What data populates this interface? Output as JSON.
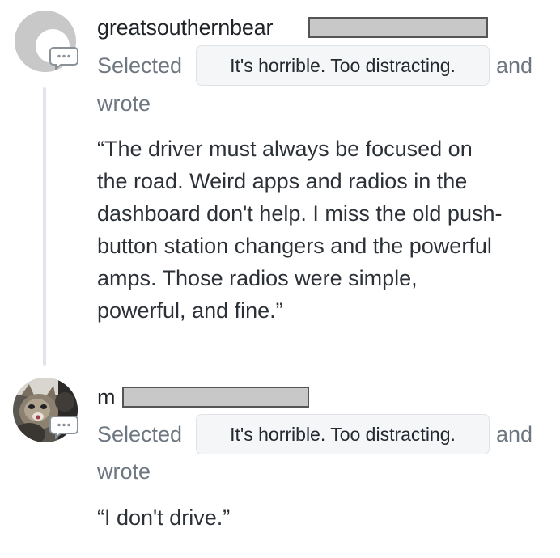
{
  "comments": [
    {
      "username": "greatsouthernbear",
      "selected_label": "Selected",
      "choice": "It's horrible. Too distracting.",
      "and_label": "and",
      "wrote_label": "wrote",
      "text": "“The driver must always be focused on\nthe road. Weird apps and radios in the\ndashboard don't help. I miss the old push-\nbutton station changers and the powerful\namps. Those radios were simple,\npowerful, and fine.”",
      "avatar": "default-avatar-icon",
      "badge": "speech-bubble-icon"
    },
    {
      "username": "m",
      "selected_label": "Selected",
      "choice": "It's horrible. Too distracting.",
      "and_label": "and",
      "wrote_label": "wrote",
      "text": "“I don't drive.”",
      "avatar": "cat-photo-avatar",
      "badge": "speech-bubble-icon"
    }
  ],
  "colors": {
    "muted_text": "#6e7781",
    "body_text": "#2c3138",
    "pill_background": "#f4f6f8",
    "thread_line": "#e1e4e8",
    "default_avatar": "#c8c8c8",
    "redaction_fill": "#c8c8c8"
  }
}
